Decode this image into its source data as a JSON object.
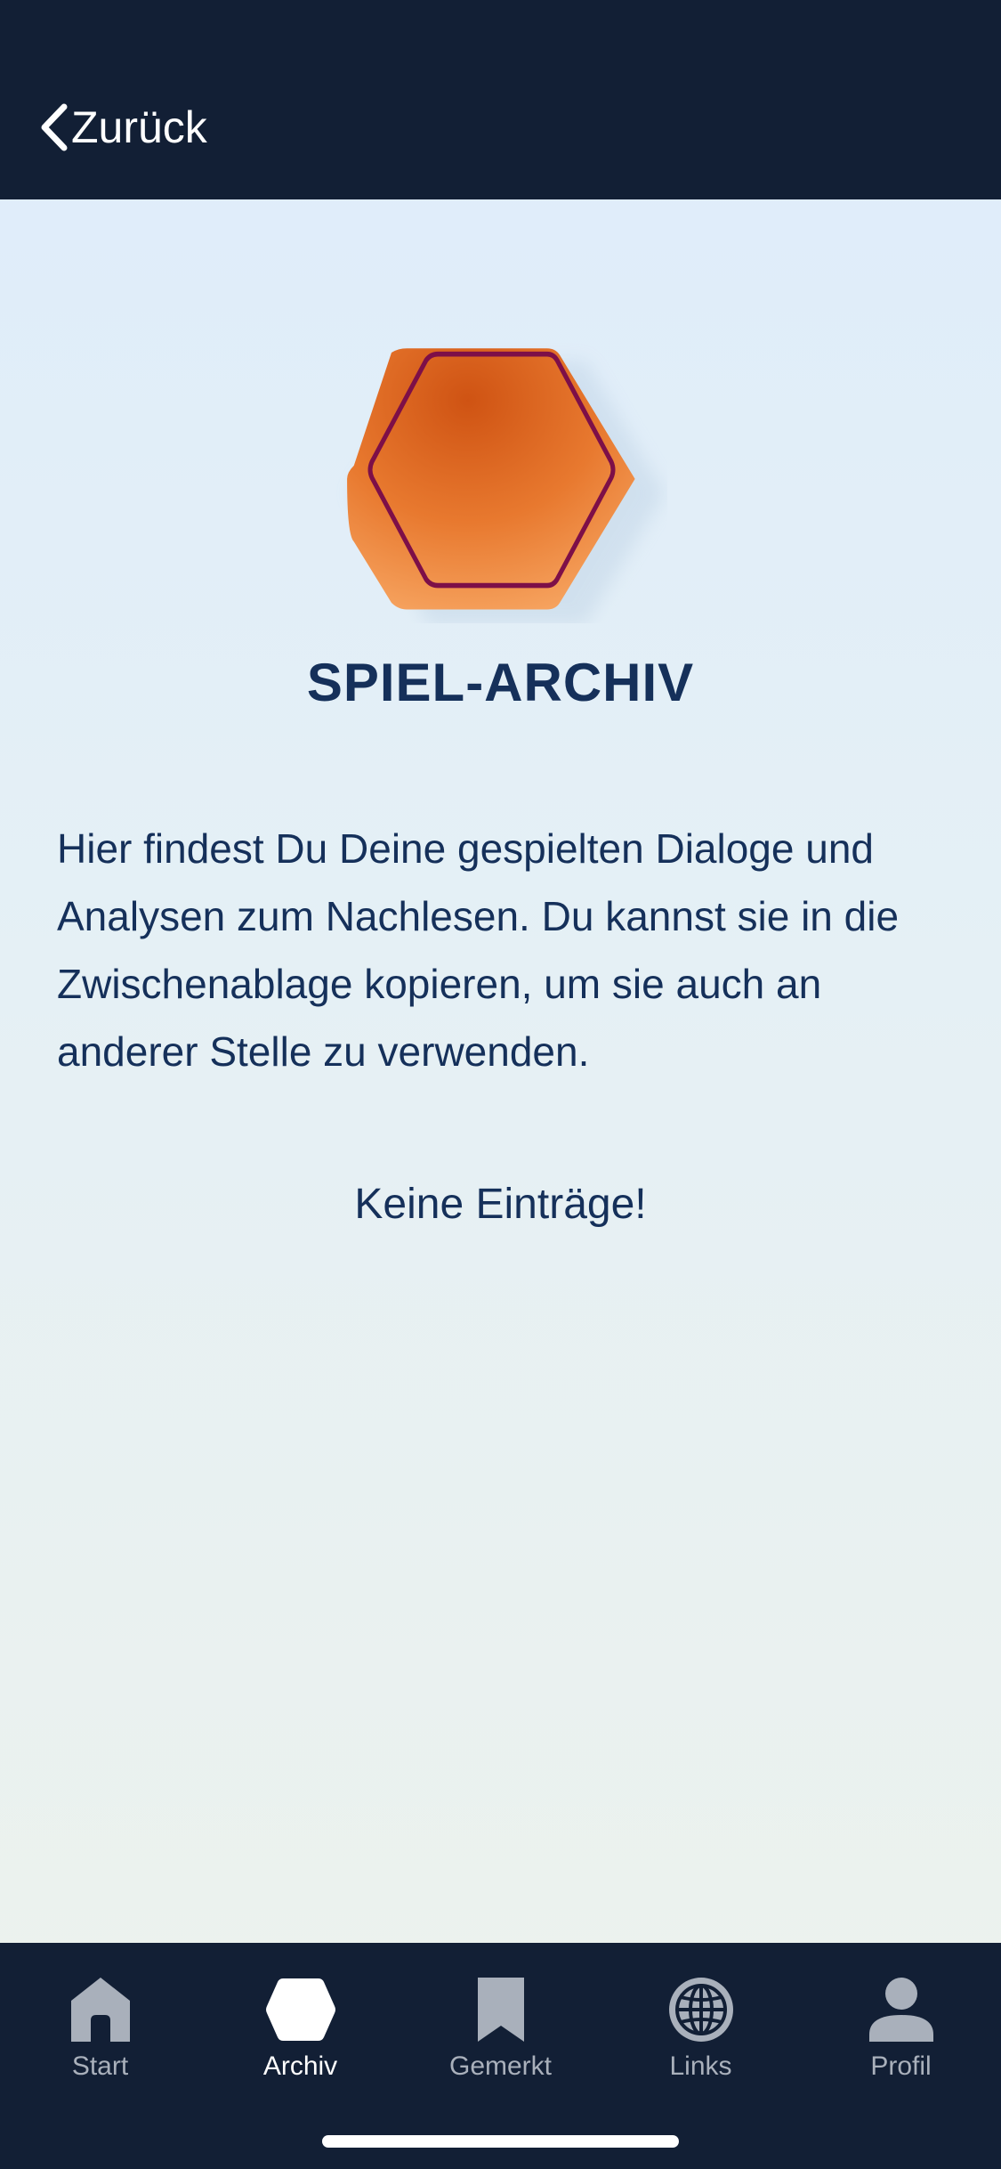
{
  "header": {
    "back_label": "Zurück"
  },
  "main": {
    "title": "SPIEL-ARCHIV",
    "intro": "Hier findest Du Deine gespielten Dialoge und Analysen zum Nachlesen. Du kannst sie in die Zwischenablage kopieren, um sie auch an anderer Stelle zu verwenden.",
    "empty_message": "Keine Einträge!"
  },
  "tabbar": {
    "active_tab": "Archiv",
    "items": [
      {
        "label": "Start",
        "icon": "home-icon"
      },
      {
        "label": "Archiv",
        "icon": "hexagon-icon"
      },
      {
        "label": "Gemerkt",
        "icon": "bookmark-icon"
      },
      {
        "label": "Links",
        "icon": "globe-icon"
      },
      {
        "label": "Profil",
        "icon": "person-icon"
      }
    ]
  },
  "colors": {
    "header_bg": "#121f35",
    "text_primary": "#15305a",
    "accent_orange": "#e8772e",
    "accent_outline": "#7d0f48",
    "tab_inactive": "#a9b0bb",
    "tab_active": "#ffffff"
  }
}
